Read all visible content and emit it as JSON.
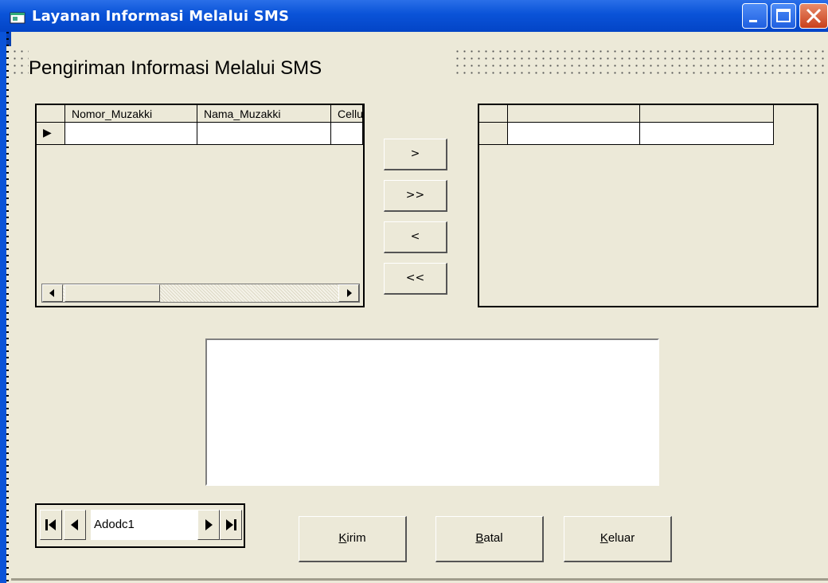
{
  "window": {
    "title": "Layanan Informasi Melalui SMS"
  },
  "form": {
    "heading": "Pengiriman Informasi Melalui SMS"
  },
  "left_grid": {
    "columns": [
      "Nomor_Muzakki",
      "Nama_Muzakki",
      "Cellu"
    ],
    "current_row_marker": "▶"
  },
  "right_grid": {
    "columns": [
      "",
      ""
    ]
  },
  "transfer_buttons": {
    "move_one": ">",
    "move_all": ">>",
    "remove_one": "<",
    "remove_all": "<<"
  },
  "message_box": {
    "value": ""
  },
  "adodc": {
    "caption": "Adodc1",
    "first": "◀",
    "prev": "◀",
    "next": "▶",
    "last": "▶"
  },
  "actions": {
    "kirim": {
      "access_key": "K",
      "rest": "irim"
    },
    "batal": {
      "access_key": "B",
      "rest": "atal"
    },
    "keluar": {
      "access_key": "K",
      "rest": "eluar"
    }
  }
}
